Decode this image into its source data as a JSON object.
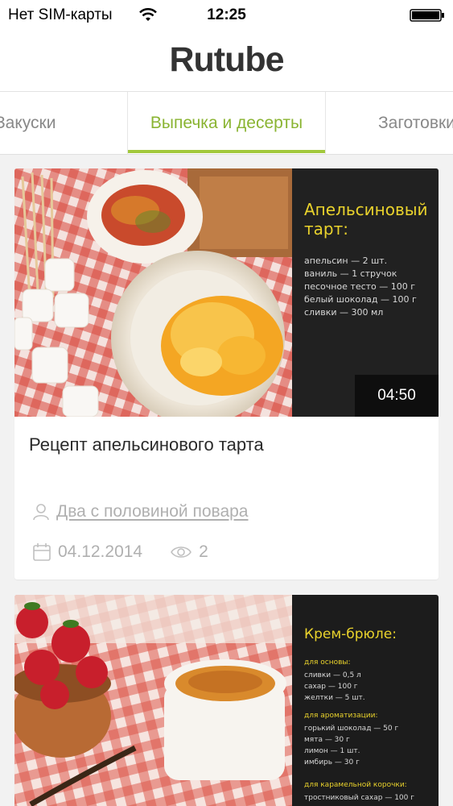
{
  "status_bar": {
    "carrier": "Нет SIM-карты",
    "time": "12:25"
  },
  "header": {
    "logo": "Rutube"
  },
  "tabs": [
    {
      "label": "Закуски",
      "active": false
    },
    {
      "label": "Выпечка и десерты",
      "active": true
    },
    {
      "label": "Заготовки",
      "active": false
    }
  ],
  "videos": [
    {
      "title": "Рецепт апельсинового тарта",
      "duration": "04:50",
      "author": "Два с половиной повара",
      "date": "04.12.2014",
      "views": "2",
      "board": {
        "title_line1": "Апельсиновый",
        "title_line2": "тарт:",
        "ingredients": [
          "апельсин — 2 шт.",
          "ваниль — 1 стручок",
          "песочное тесто — 100 г",
          "белый шоколад — 100 г",
          "сливки — 300 мл"
        ]
      }
    },
    {
      "board": {
        "title_line1": "Крем-брюле:",
        "sections": [
          {
            "heading": "для основы:",
            "lines": [
              "сливки — 0,5 л",
              "сахар — 100 г",
              "желтки — 5 шт."
            ]
          },
          {
            "heading": "для ароматизации:",
            "lines": [
              "горький шоколад — 50 г",
              "мята — 30 г",
              "лимон — 1 шт.",
              "имбирь — 30 г"
            ]
          },
          {
            "heading": "для карамельной корочки:",
            "lines": [
              "тростниковый сахар — 100 г"
            ]
          }
        ]
      }
    }
  ],
  "colors": {
    "accent": "#a2c83c",
    "active_tab_text": "#8ab432",
    "muted": "#b0b0b0",
    "chalk_yellow": "#e9d22c"
  }
}
